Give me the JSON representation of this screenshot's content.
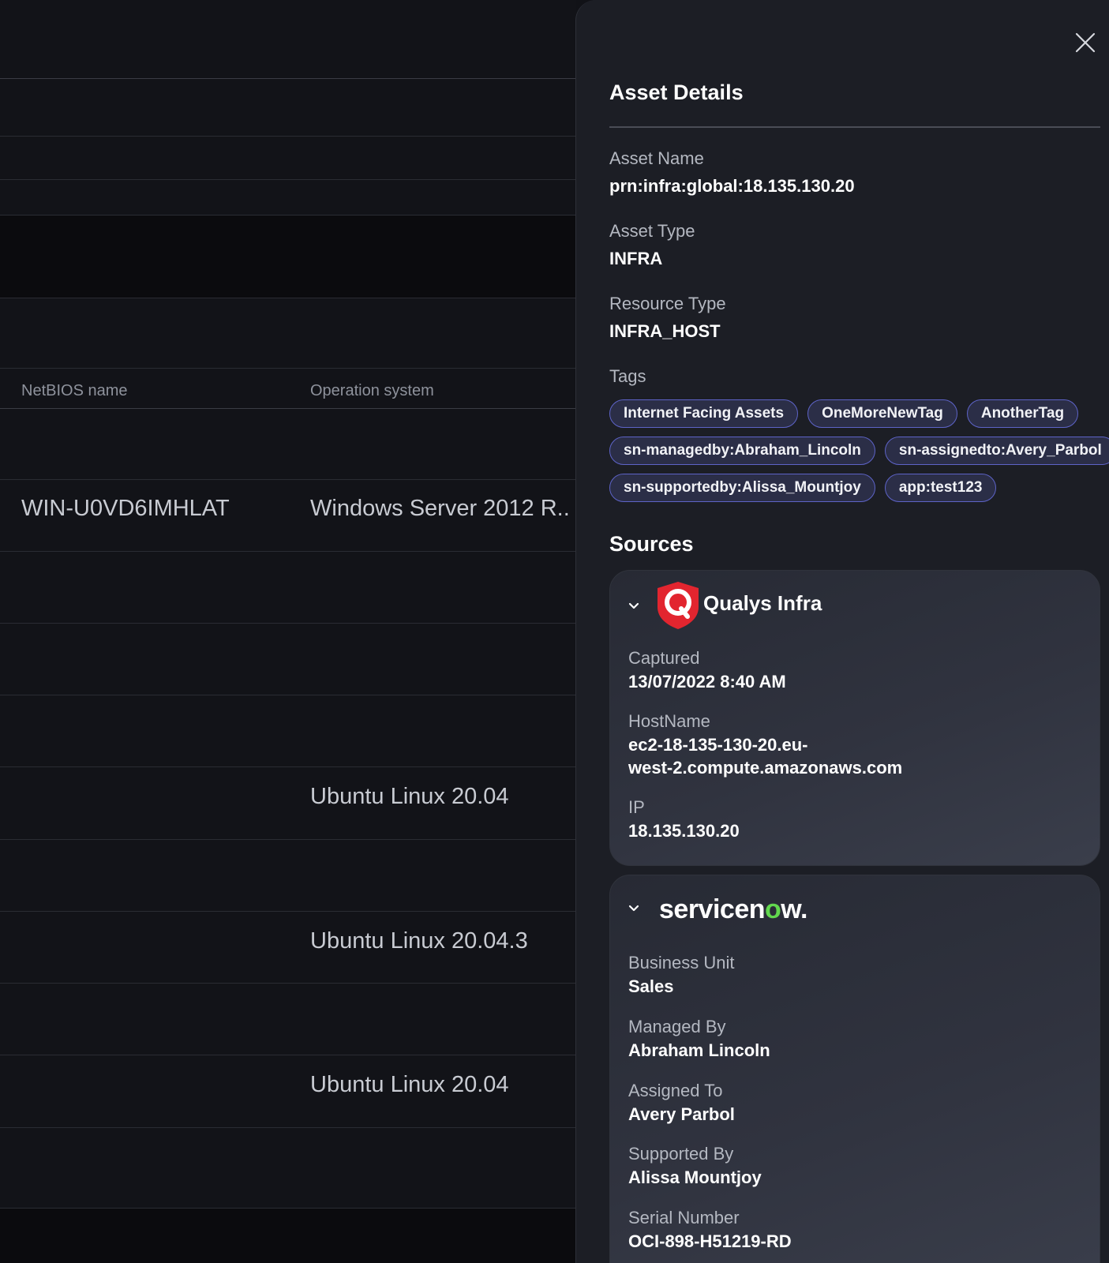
{
  "table": {
    "columns": {
      "netbios": "NetBIOS name",
      "os": "Operation system"
    },
    "rows": [
      {
        "netbios": "WIN-U0VD6IMHLAT",
        "os": "Windows Server 2012 R.."
      },
      {
        "netbios": "",
        "os": "Ubuntu Linux 20.04"
      },
      {
        "netbios": "",
        "os": "Ubuntu Linux 20.04.3"
      },
      {
        "netbios": "",
        "os": "Ubuntu Linux 20.04"
      }
    ]
  },
  "drawer": {
    "title": "Asset Details",
    "close_icon": "close-icon",
    "fields": {
      "asset_name_label": "Asset Name",
      "asset_name_value": "prn:infra:global:18.135.130.20",
      "asset_type_label": "Asset Type",
      "asset_type_value": "INFRA",
      "resource_type_label": "Resource Type",
      "resource_type_value": "INFRA_HOST",
      "tags_label": "Tags"
    },
    "tags": [
      "Internet Facing Assets",
      "OneMoreNewTag",
      "AnotherTag",
      "sn-managedby:Abraham_Lincoln",
      "sn-assignedto:Avery_Parbol",
      "sn-supportedby:Alissa_Mountjoy",
      "app:test123"
    ],
    "sources_title": "Sources",
    "qualys": {
      "name": "Qualys Infra",
      "captured_label": "Captured",
      "captured_value": "13/07/2022 8:40 AM",
      "hostname_label": "HostName",
      "hostname_value_line1": "ec2-18-135-130-20.eu-",
      "hostname_value_line2": "west-2.compute.amazonaws.com",
      "ip_label": "IP",
      "ip_value": "18.135.130.20"
    },
    "servicenow": {
      "logo_pre": "servicen",
      "logo_o": "o",
      "logo_post": "w.",
      "business_unit_label": "Business Unit",
      "business_unit_value": "Sales",
      "managed_by_label": "Managed By",
      "managed_by_value": "Abraham Lincoln",
      "assigned_to_label": "Assigned To",
      "assigned_to_value": "Avery Parbol",
      "supported_by_label": "Supported By",
      "supported_by_value": "Alissa Mountjoy",
      "serial_number_label": "Serial Number",
      "serial_number_value": "OCI-898-H51219-RD"
    }
  },
  "colors": {
    "background": "#111217",
    "drawer": "#1c1e25",
    "tag_border": "#5d63c7",
    "tag_fill": "#2b2e47",
    "qualys_red": "#e2252f",
    "servicenow_green": "#62d84e"
  }
}
